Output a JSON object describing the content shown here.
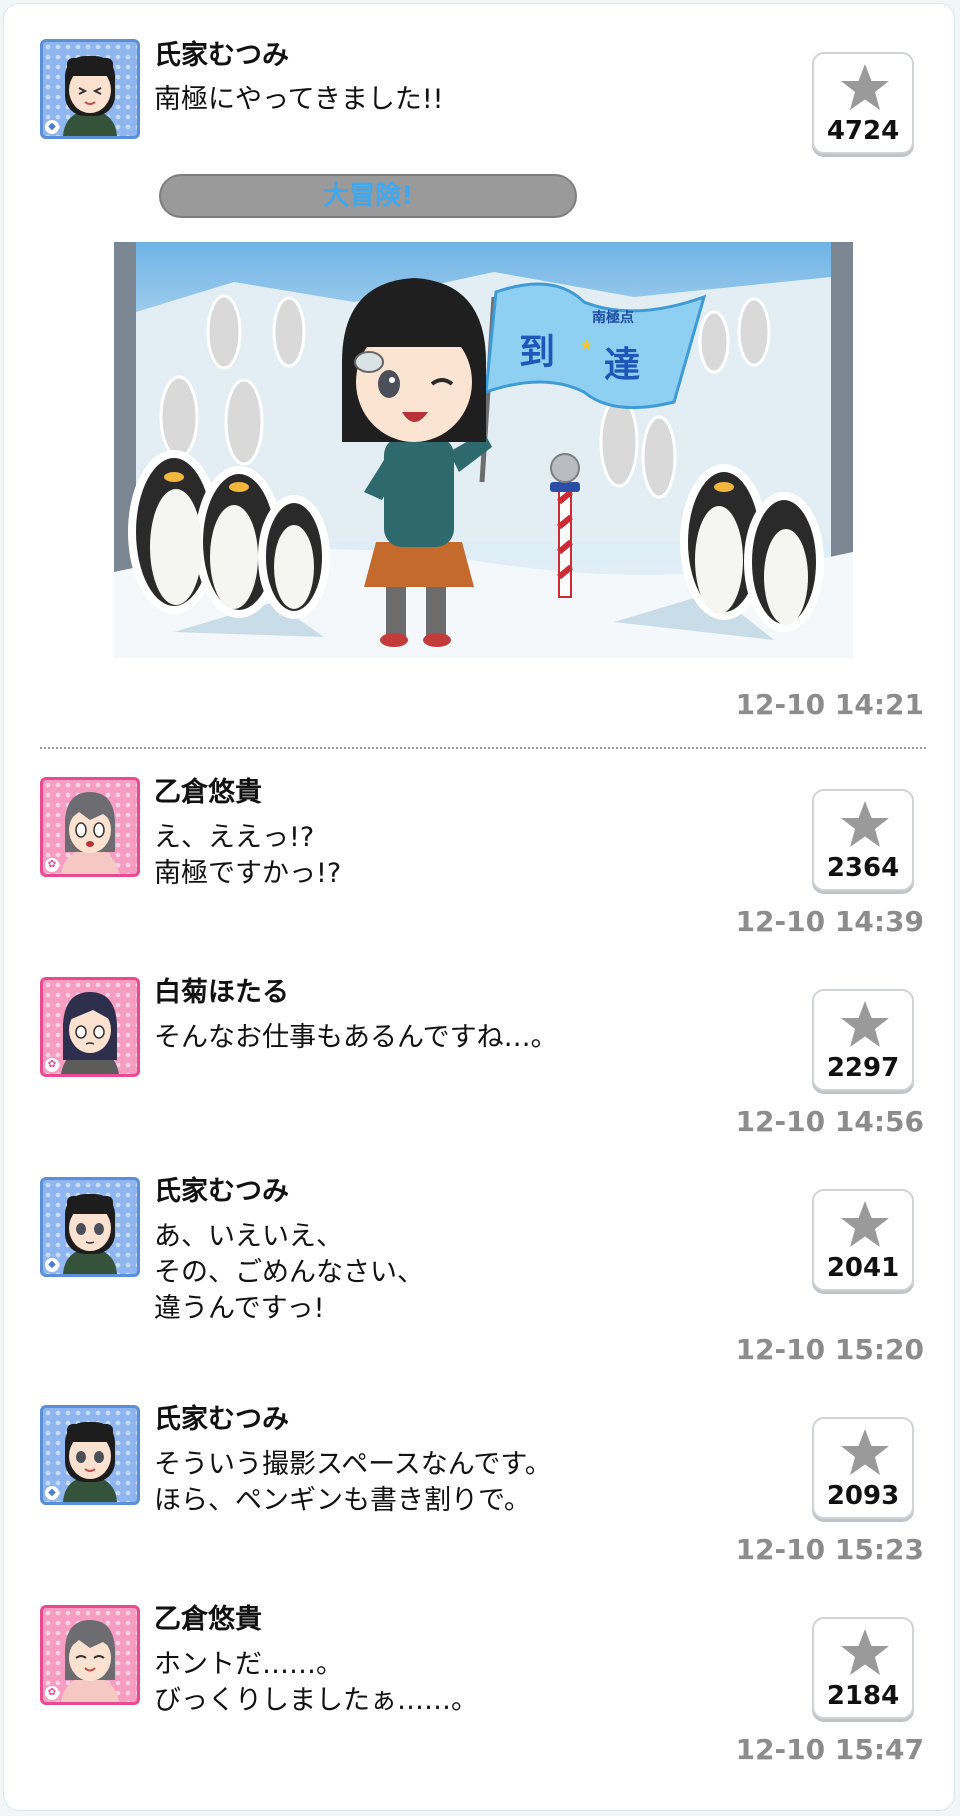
{
  "posts": [
    {
      "name": "氏家むつみ",
      "lines": [
        "南極にやってきました!!"
      ],
      "likes": "4724",
      "time": "12-10 14:21",
      "avatar": "blue",
      "caption": "大冒険!"
    },
    {
      "name": "乙倉悠貴",
      "lines": [
        "え、ええっ!?",
        "南極ですかっ!?"
      ],
      "likes": "2364",
      "time": "12-10 14:39",
      "avatar": "pink"
    },
    {
      "name": "白菊ほたる",
      "lines": [
        "そんなお仕事もあるんですね…。"
      ],
      "likes": "2297",
      "time": "12-10 14:56",
      "avatar": "pink"
    },
    {
      "name": "氏家むつみ",
      "lines": [
        "あ、いえいえ、",
        "その、ごめんなさい、",
        "違うんですっ!"
      ],
      "likes": "2041",
      "time": "12-10 15:20",
      "avatar": "blue"
    },
    {
      "name": "氏家むつみ",
      "lines": [
        "そういう撮影スペースなんです。",
        "ほら、ペンギンも書き割りで。"
      ],
      "likes": "2093",
      "time": "12-10 15:23",
      "avatar": "blue"
    },
    {
      "name": "乙倉悠貴",
      "lines": [
        "ホントだ……。",
        "びっくりしましたぁ……。"
      ],
      "likes": "2184",
      "time": "12-10 15:47",
      "avatar": "pink"
    }
  ],
  "photo_flag": {
    "top": "南極点",
    "main_left": "到",
    "main_right": "達"
  },
  "icons": {
    "like": "star-icon",
    "blue_badge": "diamond-icon",
    "pink_badge": "flower-icon"
  },
  "colors": {
    "blue_frame": "#5b8fd8",
    "pink_frame": "#e94b92",
    "timestamp": "#8c8c8c",
    "caption_text": "#3fa8ee"
  }
}
